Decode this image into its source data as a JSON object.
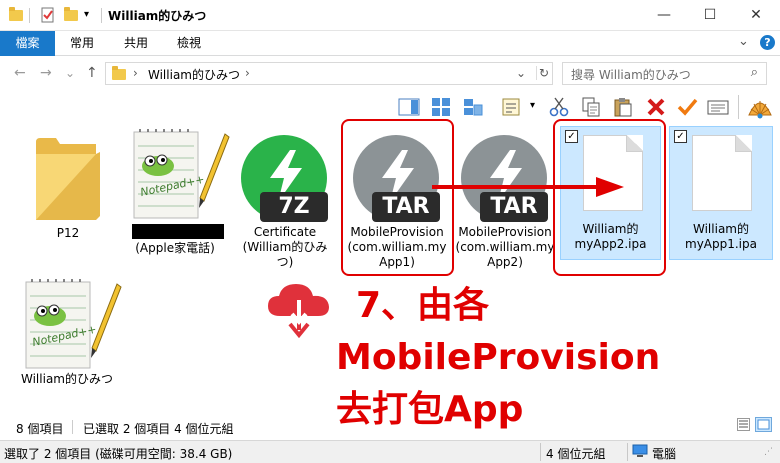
{
  "window": {
    "title": "William的ひみつ",
    "min_glyph": "—",
    "max_glyph": "☐",
    "close_glyph": "✕",
    "qa_dropdown_glyph": "▾"
  },
  "ribbon": {
    "tabs": [
      "檔案",
      "常用",
      "共用",
      "檢視"
    ],
    "expand_glyph": "⌄",
    "help_glyph": "?"
  },
  "address": {
    "back": "←",
    "forward": "→",
    "recent": "⌄",
    "up": "↑",
    "path": "William的ひみつ",
    "chevron_glyph": "›",
    "dropdown_glyph": "⌄",
    "refresh_glyph": "↻",
    "search_placeholder": "搜尋 William的ひみつ",
    "search_glyph": "⌕"
  },
  "files": [
    {
      "label": "P12",
      "kind": "folder"
    },
    {
      "label": "(Apple家電話)",
      "kind": "notepad"
    },
    {
      "label": "Certificate (William的ひみつ)",
      "kind": "7z",
      "badge": "7Z"
    },
    {
      "label": "MobileProvision (com.william.myApp1)",
      "kind": "tar",
      "badge": "TAR"
    },
    {
      "label": "MobileProvision (com.william.myApp2)",
      "kind": "tar",
      "badge": "TAR"
    },
    {
      "label": "William的 myApp2.ipa",
      "kind": "ipa",
      "selected": true
    },
    {
      "label": "William的 myApp1.ipa",
      "kind": "ipa",
      "selected": true
    },
    {
      "label": "William的ひみつ",
      "kind": "notepad"
    }
  ],
  "file_label_lines": {
    "cert": [
      "Certificate",
      "(William的ひみ",
      "つ)"
    ],
    "mp1": [
      "MobileProvision",
      "(com.william.my",
      "App1)"
    ],
    "mp2": [
      "MobileProvision",
      "(com.william.my",
      "App2)"
    ],
    "ipa2": [
      "William的",
      "myApp2.ipa"
    ],
    "ipa1": [
      "William的",
      "myApp1.ipa"
    ]
  },
  "checkbox_glyph": "✓",
  "annotation": {
    "lines": [
      "7、由各",
      "MobileProvision",
      "去打包App"
    ]
  },
  "status": {
    "item_count": "8 個項目",
    "selected": "已選取 2 個項目  4 個位元組",
    "bottom_left": "選取了 2 個項目 (磁碟可用空間: 38.4 GB)",
    "bottom_size": "4 個位元組",
    "bottom_location": "電腦"
  },
  "colors": {
    "accent": "#1979ca",
    "annotation_red": "#e00000",
    "selection": "#cce8ff",
    "green_archive": "#2ab34a",
    "gray_archive": "#8c9396"
  }
}
